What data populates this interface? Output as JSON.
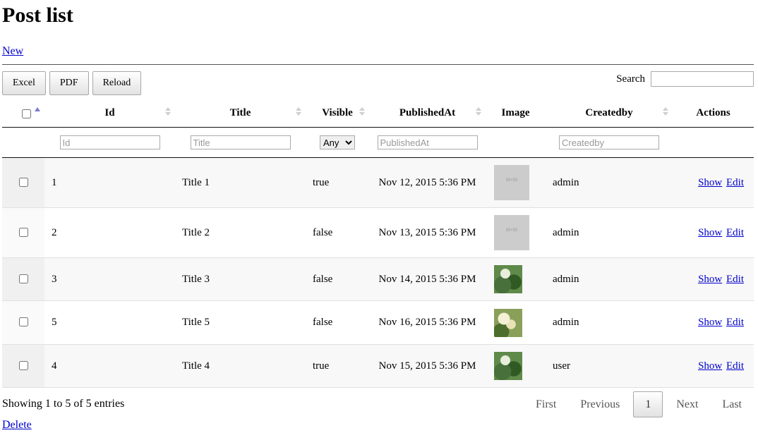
{
  "page": {
    "title": "Post list",
    "new_link": "New",
    "delete_link": "Delete"
  },
  "toolbar": {
    "excel": "Excel",
    "pdf": "PDF",
    "reload": "Reload",
    "search_label": "Search"
  },
  "columns": {
    "id": "Id",
    "title": "Title",
    "visible": "Visible",
    "published_at": "PublishedAt",
    "image": "Image",
    "created_by": "Createdby",
    "actions": "Actions"
  },
  "filters": {
    "id_placeholder": "Id",
    "title_placeholder": "Title",
    "visible_selected": "Any",
    "published_placeholder": "PublishedAt",
    "createdby_placeholder": "Createdby"
  },
  "rows": [
    {
      "id": "1",
      "title": "Title 1",
      "visible": "true",
      "published_at": "Nov 12, 2015 5:36 PM",
      "image": "placeholder-50x50",
      "created_by": "admin",
      "show": "Show",
      "edit": "Edit"
    },
    {
      "id": "2",
      "title": "Title 2",
      "visible": "false",
      "published_at": "Nov 13, 2015 5:36 PM",
      "image": "placeholder-50x50",
      "created_by": "admin",
      "show": "Show",
      "edit": "Edit"
    },
    {
      "id": "3",
      "title": "Title 3",
      "visible": "false",
      "published_at": "Nov 14, 2015 5:36 PM",
      "image": "leaf-photo",
      "created_by": "admin",
      "show": "Show",
      "edit": "Edit"
    },
    {
      "id": "5",
      "title": "Title 5",
      "visible": "false",
      "published_at": "Nov 16, 2015 5:36 PM",
      "image": "flower-photo",
      "created_by": "admin",
      "show": "Show",
      "edit": "Edit"
    },
    {
      "id": "4",
      "title": "Title 4",
      "visible": "true",
      "published_at": "Nov 15, 2015 5:36 PM",
      "image": "leaf-photo",
      "created_by": "user",
      "show": "Show",
      "edit": "Edit"
    }
  ],
  "footer": {
    "info": "Showing 1 to 5 of 5 entries"
  },
  "pagination": {
    "first": "First",
    "previous": "Previous",
    "current": "1",
    "next": "Next",
    "last": "Last"
  }
}
